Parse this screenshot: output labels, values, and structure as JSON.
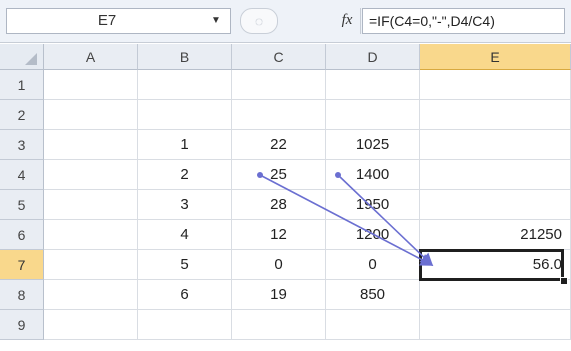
{
  "formula_bar": {
    "name_box": "E7",
    "fx_label": "fx",
    "formula": "=IF(C4=0,\"-\",D4/C4)"
  },
  "columns": [
    "A",
    "B",
    "C",
    "D",
    "E"
  ],
  "selected_column": "E",
  "rows": [
    {
      "label": "1",
      "cells": [
        "",
        "",
        "",
        "",
        ""
      ]
    },
    {
      "label": "2",
      "cells": [
        "",
        "",
        "",
        "",
        ""
      ]
    },
    {
      "label": "3",
      "cells": [
        "",
        "1",
        "22",
        "1025",
        ""
      ]
    },
    {
      "label": "4",
      "cells": [
        "",
        "2",
        "25",
        "1400",
        ""
      ]
    },
    {
      "label": "5",
      "cells": [
        "",
        "3",
        "28",
        "1950",
        ""
      ]
    },
    {
      "label": "6",
      "cells": [
        "",
        "4",
        "12",
        "1200",
        "21250"
      ]
    },
    {
      "label": "7",
      "cells": [
        "",
        "5",
        "0",
        "0",
        "56.0"
      ]
    },
    {
      "label": "8",
      "cells": [
        "",
        "6",
        "19",
        "850",
        ""
      ]
    },
    {
      "label": "9",
      "cells": [
        "",
        "",
        "",
        "",
        ""
      ]
    }
  ],
  "selected_row": "7",
  "active_cell": "E7",
  "trace_precedents": {
    "from": [
      "C4",
      "D4"
    ],
    "to": "E7",
    "color": "#6b6fd1"
  }
}
